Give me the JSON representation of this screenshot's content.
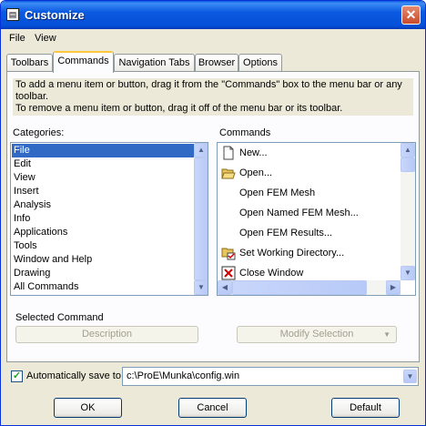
{
  "window": {
    "title": "Customize",
    "close_glyph": "✕"
  },
  "menubar": {
    "items": [
      {
        "label": "File"
      },
      {
        "label": "View"
      }
    ]
  },
  "tabs": [
    {
      "label": "Toolbars"
    },
    {
      "label": "Commands",
      "active": true
    },
    {
      "label": "Navigation Tabs"
    },
    {
      "label": "Browser"
    },
    {
      "label": "Options"
    }
  ],
  "hint": {
    "line1": "To add a menu item or button, drag it from the \"Commands\" box to the menu bar or any toolbar.",
    "line2": "To remove a menu item or button, drag it off of the menu bar or its toolbar."
  },
  "categories": {
    "label": "Categories:",
    "items": [
      {
        "label": "File",
        "selected": true
      },
      {
        "label": "Edit"
      },
      {
        "label": "View"
      },
      {
        "label": "Insert"
      },
      {
        "label": "Analysis"
      },
      {
        "label": "Info"
      },
      {
        "label": "Applications"
      },
      {
        "label": "Tools"
      },
      {
        "label": "Window and Help"
      },
      {
        "label": "Drawing"
      },
      {
        "label": "All Commands"
      }
    ]
  },
  "commands": {
    "label": "Commands",
    "items": [
      {
        "label": "New...",
        "icon": "new-document-icon"
      },
      {
        "label": "Open...",
        "icon": "open-folder-icon"
      },
      {
        "label": "Open FEM Mesh",
        "icon": ""
      },
      {
        "label": "Open Named FEM Mesh...",
        "icon": ""
      },
      {
        "label": "Open FEM Results...",
        "icon": ""
      },
      {
        "label": "Set Working Directory...",
        "icon": "folder-check-icon"
      },
      {
        "label": "Close Window",
        "icon": "close-window-icon"
      }
    ]
  },
  "selected_command": {
    "label": "Selected Command",
    "description_button": "Description",
    "modify_button": "Modify Selection"
  },
  "autosave": {
    "checked": true,
    "label": "Automatically save to",
    "path": "c:\\ProE\\Munka\\config.win"
  },
  "footer": {
    "ok": "OK",
    "cancel": "Cancel",
    "default": "Default"
  },
  "colors": {
    "title_bar": "#0a5ae0",
    "selection": "#316ac5",
    "dialog_bg": "#ece9d8"
  }
}
